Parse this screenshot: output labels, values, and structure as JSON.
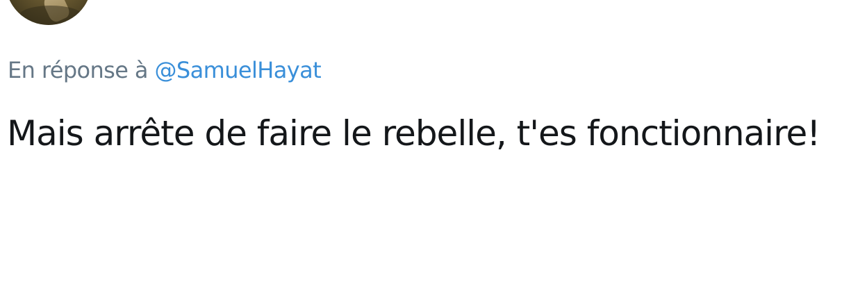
{
  "reply": {
    "prefix": "En réponse à",
    "handle": "@SamuelHayat"
  },
  "tweet": {
    "text": "Mais arrête de faire le rebelle, t'es fonctionnaire!"
  },
  "colors": {
    "muted_text": "#657786",
    "link": "#3a8fd9",
    "body_text": "#14171a",
    "background": "#ffffff"
  }
}
